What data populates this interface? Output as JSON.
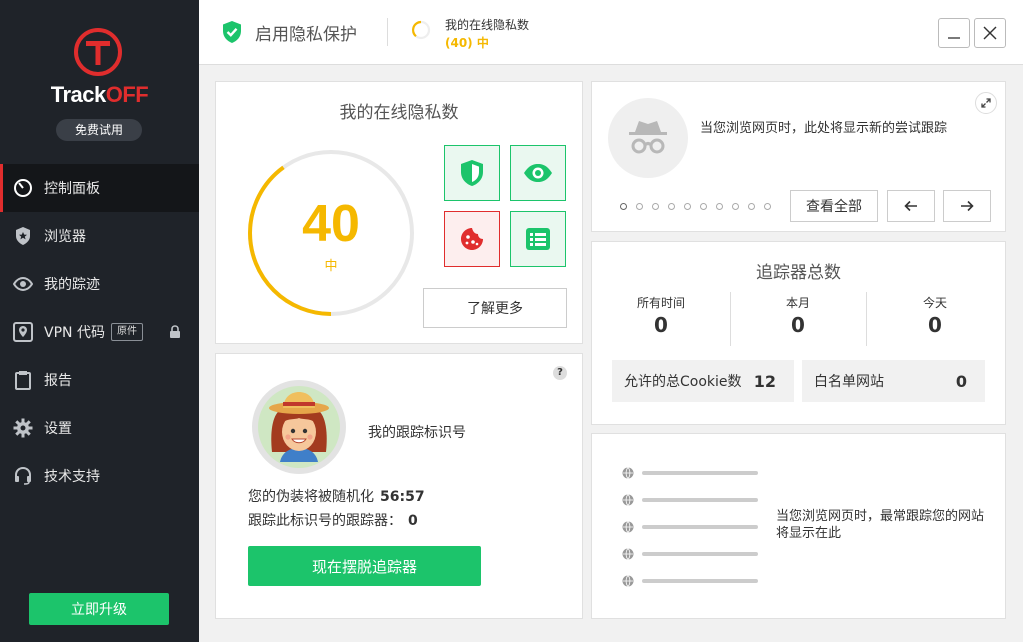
{
  "sidebar": {
    "brand_part1": "Track",
    "brand_part2": "OFF",
    "trial_badge": "免费试用",
    "items": [
      {
        "label": "控制面板"
      },
      {
        "label": "浏览器"
      },
      {
        "label": "我的踪迹"
      },
      {
        "label": "VPN 代码",
        "tag": "原件"
      },
      {
        "label": "报告"
      },
      {
        "label": "设置"
      },
      {
        "label": "技术支持"
      }
    ],
    "upgrade_label": "立即升级"
  },
  "header": {
    "title": "启用隐私保护",
    "score_label": "我的在线隐私数",
    "score_value": "(40) 中"
  },
  "score_card": {
    "title": "我的在线隐私数",
    "score": "40",
    "level": "中",
    "score_fraction": 0.4,
    "learn_more": "了解更多"
  },
  "identity_card": {
    "label": "我的跟踪标识号",
    "disguise_text": "您的伪装将被随机化",
    "disguise_timer": "56:57",
    "trackers_text": "跟踪此标识号的跟踪器：",
    "trackers_count": "0",
    "escape_button": "现在摆脱追踪器"
  },
  "tracking_card": {
    "message": "当您浏览网页时，此处将显示新的尝试跟踪",
    "view_all": "查看全部"
  },
  "totals_card": {
    "title": "追踪器总数",
    "stats": [
      {
        "label": "所有时间",
        "value": "0"
      },
      {
        "label": "本月",
        "value": "0"
      },
      {
        "label": "今天",
        "value": "0"
      }
    ],
    "cookies_label": "允许的总Cookie数",
    "cookies_value": "12",
    "whitelist_label": "白名单网站",
    "whitelist_value": "0"
  },
  "sites_card": {
    "message": "当您浏览网页时，最常跟踪您的网站将显示在此"
  },
  "colors": {
    "accent_green": "#1cc46b",
    "score_yellow": "#f5b800",
    "brand_red": "#e02d2d",
    "sidebar_bg": "#1f2329"
  }
}
